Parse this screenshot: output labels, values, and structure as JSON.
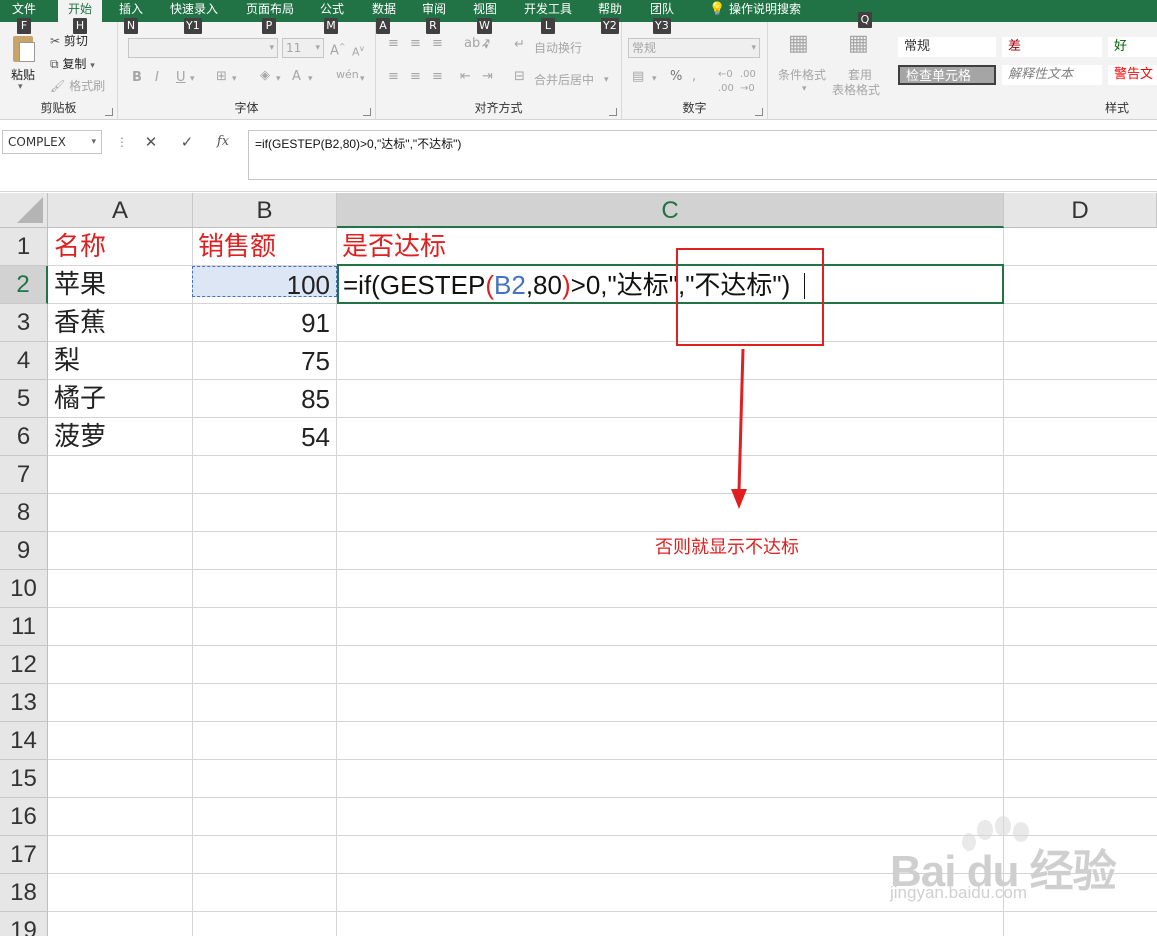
{
  "ribbon": {
    "tabs": [
      {
        "label": "文件",
        "keytip": "F"
      },
      {
        "label": "开始",
        "keytip": "H"
      },
      {
        "label": "插入",
        "keytip": "N"
      },
      {
        "label": "快速录入",
        "keytip": "Y1"
      },
      {
        "label": "页面布局",
        "keytip": "P"
      },
      {
        "label": "公式",
        "keytip": "M"
      },
      {
        "label": "数据",
        "keytip": "A"
      },
      {
        "label": "审阅",
        "keytip": "R"
      },
      {
        "label": "视图",
        "keytip": "W"
      },
      {
        "label": "开发工具",
        "keytip": "L"
      },
      {
        "label": "帮助",
        "keytip": "Y2"
      },
      {
        "label": "团队",
        "keytip": "Y3"
      }
    ],
    "tell_me": "操作说明搜索",
    "tell_me_keytip": "Q",
    "active_tab": "开始",
    "clipboard": {
      "paste": "粘贴",
      "cut": "剪切",
      "copy": "复制",
      "format_painter": "格式刷",
      "label": "剪贴板"
    },
    "font": {
      "size": "11",
      "bold": "B",
      "italic": "I",
      "underline": "U",
      "label": "字体"
    },
    "alignment": {
      "wrap_text": "自动换行",
      "merge_center": "合并后居中",
      "label": "对齐方式"
    },
    "number": {
      "format": "常规",
      "percent": "%",
      "label": "数字"
    },
    "styles": {
      "conditional_format": "条件格式",
      "table_format_1": "套用",
      "table_format_2": "表格格式",
      "normal": "常规",
      "bad": "差",
      "good": "好",
      "check_cell": "检查单元格",
      "explanatory": "解释性文本",
      "warning": "警告文",
      "label": "样式"
    }
  },
  "formula_bar": {
    "name_box": "COMPLEX",
    "cancel": "✕",
    "enter": "✓",
    "fx": "fx",
    "formula": "=if(GESTEP(B2,80)>0,\"达标\",\"不达标\")"
  },
  "sheet": {
    "columns": [
      "A",
      "B",
      "C",
      "D"
    ],
    "rows": [
      "1",
      "2",
      "3",
      "4",
      "5",
      "6",
      "7",
      "8",
      "9",
      "10",
      "11",
      "12",
      "13",
      "14",
      "15",
      "16",
      "17",
      "18",
      "19"
    ],
    "headers": {
      "a": "名称",
      "b": "销售额",
      "c": "是否达标"
    },
    "data": [
      {
        "name": "苹果",
        "sales": "100"
      },
      {
        "name": "香蕉",
        "sales": "91"
      },
      {
        "name": "梨",
        "sales": "75"
      },
      {
        "name": "橘子",
        "sales": "85"
      },
      {
        "name": "菠萝",
        "sales": "54"
      }
    ],
    "edit_formula": {
      "p1": "=if(GESTEP",
      "p2": "(",
      "p3": "B2",
      "p4": ",80",
      "p5": ")",
      "p6": ">0,\"达标\",\"不达标\")"
    }
  },
  "annotation": {
    "text": "否则就显示不达标",
    "color": "#e02020"
  },
  "watermark": {
    "brand": "Bai du 经验",
    "url": "jingyan.baidu.com"
  },
  "colors": {
    "accent": "#217346",
    "annotation": "#e02020",
    "reference": "#4472c4"
  }
}
